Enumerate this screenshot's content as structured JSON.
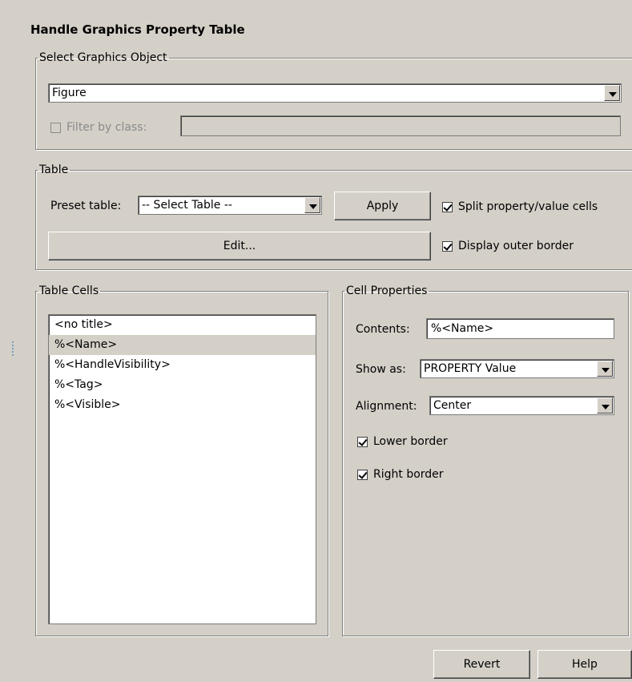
{
  "title": "Handle Graphics Property Table",
  "select_object": {
    "legend": "Select Graphics Object",
    "object_value": "Figure",
    "filter_label": "Filter by class:",
    "filter_checked": false,
    "filter_value": ""
  },
  "table": {
    "legend": "Table",
    "preset_label": "Preset table:",
    "preset_value": "-- Select Table --",
    "apply_label": "Apply",
    "split_label": "Split property/value cells",
    "split_checked": true,
    "edit_label": "Edit...",
    "outer_border_label": "Display outer border",
    "outer_border_checked": true
  },
  "table_cells": {
    "legend": "Table Cells",
    "items": [
      "<no title>",
      "%<Name>",
      "%<HandleVisibility>",
      "%<Tag>",
      "%<Visible>"
    ],
    "selected_index": 1
  },
  "cell_properties": {
    "legend": "Cell Properties",
    "contents_label": "Contents:",
    "contents_value": "%<Name>",
    "show_as_label": "Show as:",
    "show_as_value": "PROPERTY Value",
    "alignment_label": "Alignment:",
    "alignment_value": "Center",
    "lower_border_label": "Lower border",
    "lower_border_checked": true,
    "right_border_label": "Right border",
    "right_border_checked": true
  },
  "footer": {
    "revert_label": "Revert",
    "help_label": "Help"
  }
}
